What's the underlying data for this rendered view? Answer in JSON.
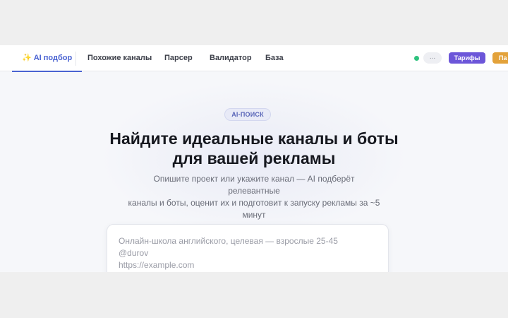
{
  "nav": {
    "tabs": [
      {
        "label": "AI подбор",
        "active": true
      },
      {
        "label": "Похожие каналы"
      },
      {
        "label": "Парсер"
      },
      {
        "label": "Валидатор"
      },
      {
        "label": "База"
      }
    ],
    "user_label": "...",
    "pricing_label": "Тарифы",
    "orange_label": "Па"
  },
  "hero": {
    "badge": "AI-ПОИСК",
    "title_line1": "Найдите идеальные каналы и боты",
    "title_line2": "для вашей рекламы",
    "subtitle_line1": "Опишите проект или укажите канал — AI подберёт релевантные",
    "subtitle_line2": "каналы и боты, оценит их и подготовит к запуску рекламы за ~5",
    "subtitle_line3": "минут"
  },
  "input": {
    "placeholder_lines": [
      "Онлайн-школа английского, целевая — взрослые 25-45",
      "@durov",
      "https://example.com"
    ]
  },
  "colors": {
    "accent": "#4a63d2",
    "pricing": "#6c56d9",
    "orange": "#e3a23a",
    "status": "#2ec27e"
  }
}
